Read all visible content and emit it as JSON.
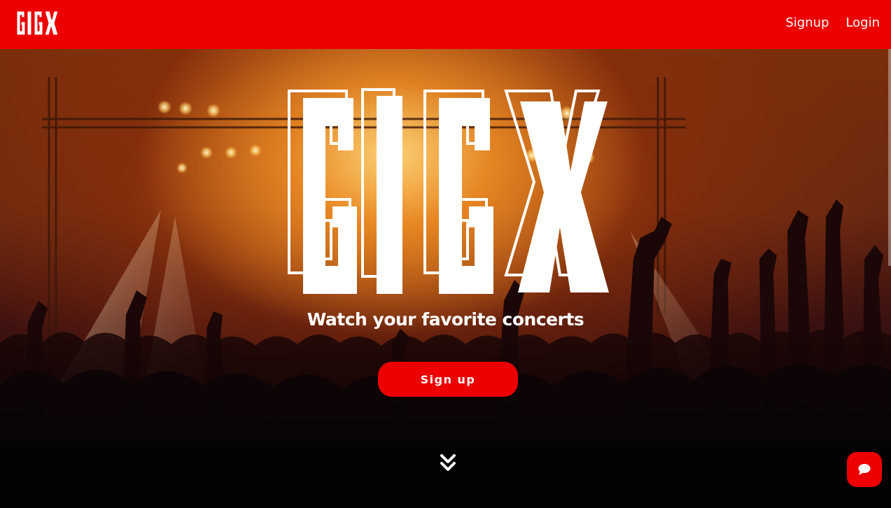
{
  "navbar": {
    "logo_text": "GIGX",
    "links": [
      {
        "label": "Signup"
      },
      {
        "label": "Login"
      }
    ],
    "background": "#ec0000"
  },
  "hero": {
    "logo_text": "GIGX",
    "tagline": "Watch your favorite concerts",
    "cta_label": "Sign up",
    "scroll_icon": "double-chevron-down-icon"
  },
  "chat": {
    "icon": "chat-bubble-icon",
    "color": "#ec0000"
  }
}
